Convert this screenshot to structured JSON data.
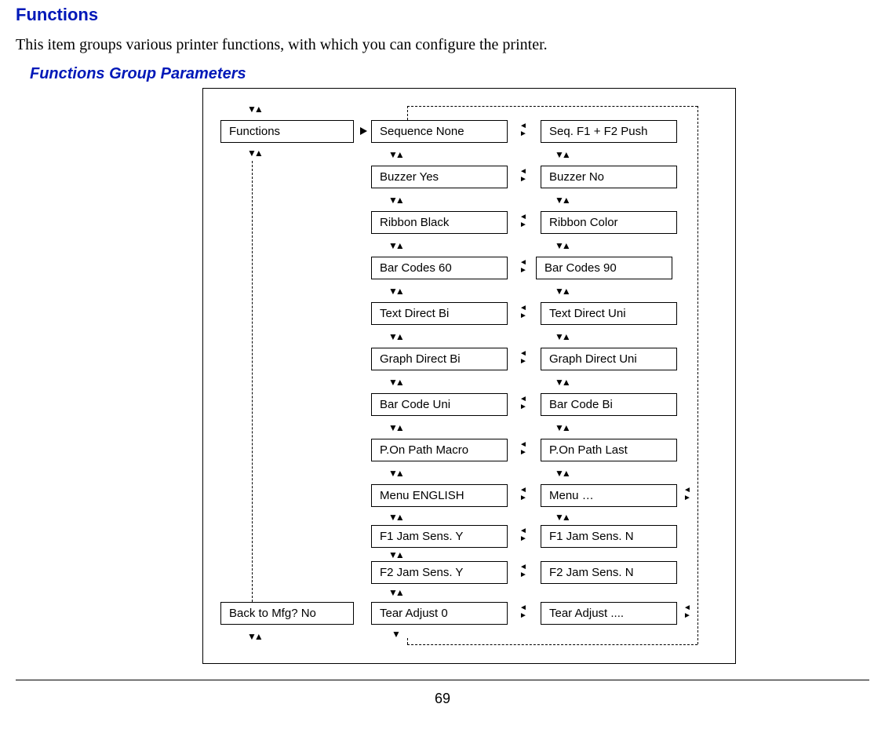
{
  "title": "Functions",
  "intro": "This item groups various printer functions, with which you can configure the printer.",
  "sub": "Functions Group Parameters",
  "boxes": {
    "functions": "Functions",
    "back_mfg": "Back to Mfg? No",
    "col2": {
      "r0": "Sequence None",
      "r1": "Buzzer Yes",
      "r2": "Ribbon Black",
      "r3": "Bar Codes 60",
      "r4": "Text Direct Bi",
      "r5": "Graph Direct Bi",
      "r6": "Bar Code Uni",
      "r7": "P.On Path Macro",
      "r8": "Menu ENGLISH",
      "r9": "F1 Jam Sens. Y",
      "r10": "F2 Jam Sens. Y",
      "r11": "Tear Adjust 0"
    },
    "col3": {
      "r0": "Seq. F1 + F2 Push",
      "r1": "Buzzer No",
      "r2": "Ribbon Color",
      "r3": "Bar Codes 90",
      "r4": "Text Direct Uni",
      "r5": "Graph Direct Uni",
      "r6": "Bar Code Bi",
      "r7": "P.On Path Last",
      "r8": "Menu …",
      "r9": "F1 Jam Sens. N",
      "r10": "F2 Jam Sens. N",
      "r11": "Tear Adjust ...."
    }
  },
  "pagenum": "69"
}
